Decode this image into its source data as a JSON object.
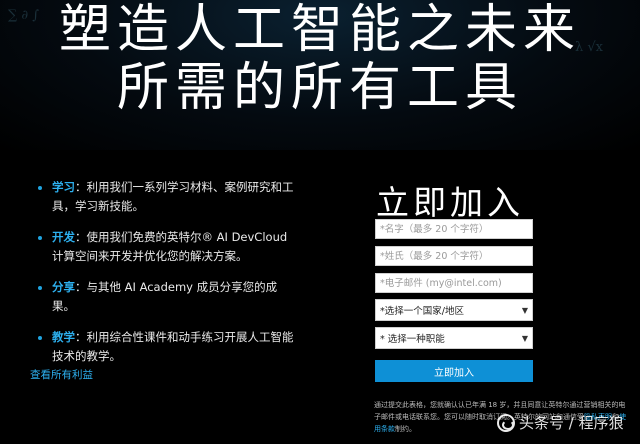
{
  "hero": {
    "title_line1": "塑造人工智能之未来",
    "title_line2": "所需的所有工具"
  },
  "benefits": [
    {
      "term": "学习",
      "text": "：利用我们一系列学习材料、案例研究和工具，学习新技能。"
    },
    {
      "term": "开发",
      "text": "：使用我们免费的英特尔® AI DevCloud 计算空间来开发并优化您的解决方案。"
    },
    {
      "term": "分享",
      "text": "：与其他 AI Academy 成员分享您的成果。"
    },
    {
      "term": "教学",
      "text": "：利用综合性课件和动手练习开展人工智能技术的教学。"
    }
  ],
  "view_all_link": "查看所有利益",
  "form": {
    "title": "立即加入",
    "first_name_placeholder": "*名字（最多 20 个字符）",
    "last_name_placeholder": "*姓氏（最多 20 个字符）",
    "email_placeholder": "*电子邮件 (my@intel.com)",
    "country_value": "*选择一个国家/地区",
    "role_value": "* 选择一种职能",
    "submit_label": "立即加入",
    "legal_prefix": "通过提交此表格，您就确认认已年满 18 岁，并且同意让英特尔通过营销相关的电子邮件或电话联系您。您可以随时取消订阅。英特尔的网站和通信受",
    "privacy_link": "隐私声明",
    "legal_mid": "和",
    "terms_link": "使用条款",
    "legal_suffix": "制约。"
  },
  "watermark": {
    "text": "头条号 / 程序狼"
  },
  "colors": {
    "accent": "#2db0ef",
    "button": "#0e90d6",
    "background": "#000000"
  }
}
